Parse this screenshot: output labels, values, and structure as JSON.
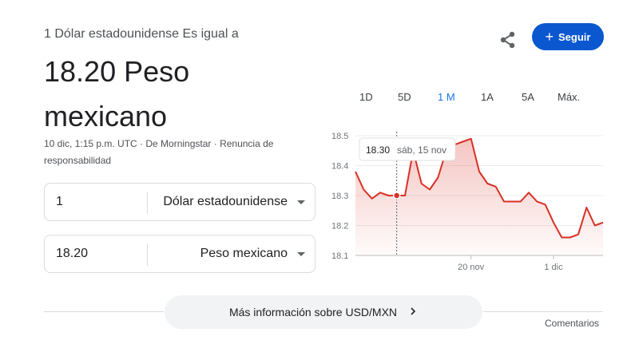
{
  "header": {
    "subtitle": "1 Dólar estadounidense Es igual a",
    "result": "18.20 Peso mexicano",
    "meta": "10 dic, 1:15 p.m. UTC · De Morningstar · Renuncia de responsabilidad"
  },
  "actions": {
    "share_icon": "share-icon",
    "follow_label": "Seguir"
  },
  "converter": {
    "from": {
      "amount": "1",
      "currency": "Dólar estadounidense"
    },
    "to": {
      "amount": "18.20",
      "currency": "Peso mexicano"
    }
  },
  "ranges": [
    {
      "label": "1D",
      "active": false
    },
    {
      "label": "5D",
      "active": false
    },
    {
      "label": "1 M",
      "active": true
    },
    {
      "label": "1A",
      "active": false
    },
    {
      "label": "5A",
      "active": false
    },
    {
      "label": "Máx.",
      "active": false
    }
  ],
  "tooltip": {
    "value": "18.30",
    "date": "sáb, 15 nov"
  },
  "chart_data": {
    "type": "area",
    "x_ticks": [
      "20 nov",
      "1 dic"
    ],
    "y_ticks": [
      "18.5",
      "18.4",
      "18.3",
      "18.2",
      "18.1"
    ],
    "ylim": [
      18.1,
      18.5
    ],
    "color": "#d93025",
    "values": [
      18.38,
      18.32,
      18.29,
      18.31,
      18.3,
      18.3,
      18.3,
      18.45,
      18.34,
      18.32,
      18.36,
      18.45,
      18.47,
      18.48,
      18.49,
      18.38,
      18.34,
      18.33,
      18.28,
      18.28,
      18.28,
      18.31,
      18.28,
      18.27,
      18.21,
      18.16,
      18.16,
      18.17,
      18.26,
      18.2,
      18.21
    ],
    "highlight_index": 5
  },
  "footer": {
    "more_label": "Más información sobre USD/MXN",
    "more_icon": "chevron-right-icon",
    "comments_label": "Comentarios"
  }
}
